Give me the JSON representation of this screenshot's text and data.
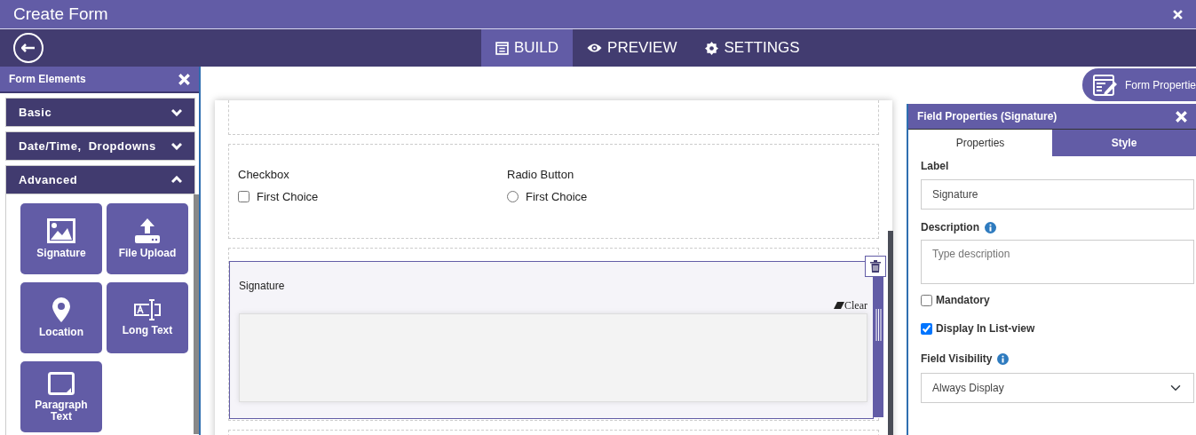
{
  "window": {
    "title": "Create Form"
  },
  "nav_tabs": [
    {
      "label": "BUILD",
      "selected": true
    },
    {
      "label": "PREVIEW",
      "selected": false
    },
    {
      "label": "SETTINGS",
      "selected": false
    }
  ],
  "form_elements": {
    "title": "Form Elements",
    "sections": [
      {
        "label": "Basic",
        "expanded": false
      },
      {
        "label": "Date/Time,  Dropdowns",
        "expanded": false
      },
      {
        "label": "Advanced",
        "expanded": true
      }
    ],
    "tiles": [
      {
        "label": "Signature"
      },
      {
        "label": "File Upload"
      },
      {
        "label": "Location"
      },
      {
        "label": "Long Text"
      },
      {
        "label": "Paragraph Text"
      }
    ]
  },
  "form_properties_button": {
    "label": "Form Propertie"
  },
  "canvas": {
    "fields": [
      {
        "kind": "checkbox",
        "label": "Checkbox",
        "option": "First Choice",
        "checked": false
      },
      {
        "kind": "radio",
        "label": "Radio Button",
        "option": "First Choice",
        "checked": false
      }
    ],
    "signature_field": {
      "label": "Signature",
      "clear": "Clear",
      "selected": true
    }
  },
  "field_properties": {
    "title": "Field Properties (Signature)",
    "tabs": [
      {
        "label": "Properties",
        "selected": true
      },
      {
        "label": "Style",
        "selected": false
      }
    ],
    "label_caption": "Label",
    "label_value": "Signature",
    "description_caption": "Description",
    "description_placeholder": "Type description",
    "checks": [
      {
        "label": "Mandatory",
        "checked": false
      },
      {
        "label": "Display In List-view",
        "checked": true
      }
    ],
    "visibility_caption": "Field Visibility",
    "visibility_value": "Always Display"
  }
}
